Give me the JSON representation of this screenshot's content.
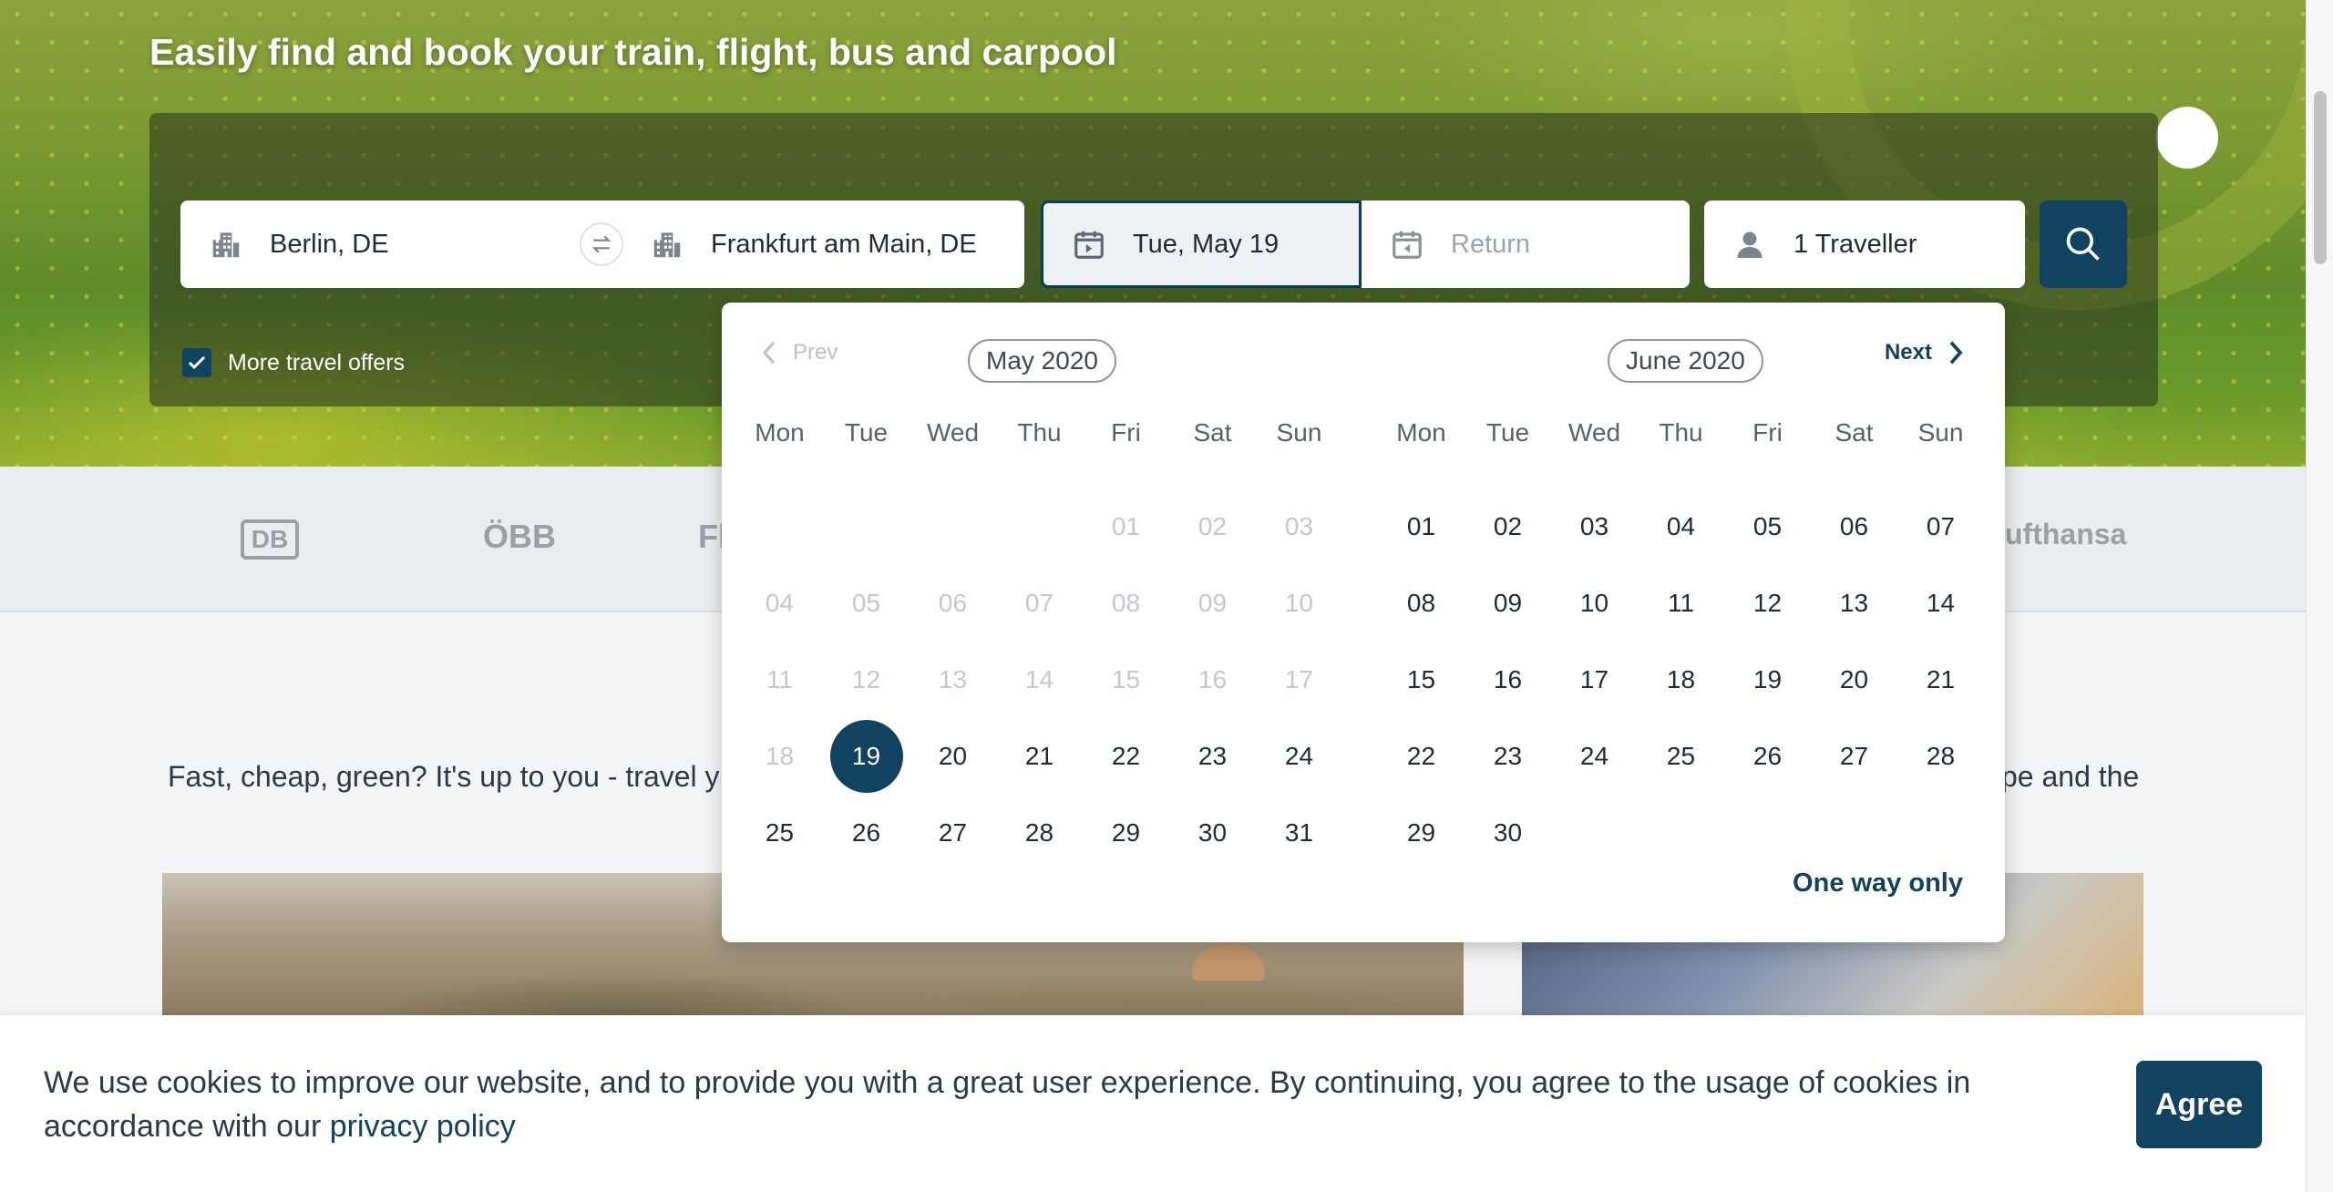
{
  "hero": {
    "title": "Easily find and book your train, flight, bus and carpool"
  },
  "search": {
    "from_value": "Berlin, DE",
    "to_value": "Frankfurt am Main, DE",
    "depart_value": "Tue, May 19",
    "return_placeholder": "Return",
    "travellers_value": "1 Traveller",
    "more_offers_label": "More travel offers",
    "more_offers_checked": true,
    "icons": {
      "from": "building-icon",
      "to": "building-icon",
      "swap": "swap-arrows-icon",
      "depart": "calendar-icon",
      "return": "calendar-icon",
      "travellers": "person-icon",
      "search": "search-icon"
    }
  },
  "calendar": {
    "prev_label": "Prev",
    "next_label": "Next",
    "one_way_label": "One way only",
    "weekdays": [
      "Mon",
      "Tue",
      "Wed",
      "Thu",
      "Fri",
      "Sat",
      "Sun"
    ],
    "selected_day": "19",
    "months": [
      {
        "label": "May 2020",
        "weeks": [
          [
            "",
            "",
            "",
            "",
            "01",
            "02",
            "03"
          ],
          [
            "04",
            "05",
            "06",
            "07",
            "08",
            "09",
            "10"
          ],
          [
            "11",
            "12",
            "13",
            "14",
            "15",
            "16",
            "17"
          ],
          [
            "18",
            "19",
            "20",
            "21",
            "22",
            "23",
            "24"
          ],
          [
            "25",
            "26",
            "27",
            "28",
            "29",
            "30",
            "31"
          ]
        ],
        "disabled_through": 18,
        "selected": 19
      },
      {
        "label": "June 2020",
        "weeks": [
          [
            "01",
            "02",
            "03",
            "04",
            "05",
            "06",
            "07"
          ],
          [
            "08",
            "09",
            "10",
            "11",
            "12",
            "13",
            "14"
          ],
          [
            "15",
            "16",
            "17",
            "18",
            "19",
            "20",
            "21"
          ],
          [
            "22",
            "23",
            "24",
            "25",
            "26",
            "27",
            "28"
          ],
          [
            "29",
            "30",
            "",
            "",
            "",
            "",
            ""
          ]
        ],
        "disabled_through": 0,
        "selected": null
      }
    ]
  },
  "partners": {
    "db": "DB",
    "obb": "ÖBB",
    "fl_partial": "Fl",
    "lufthansa_partial": "ufthansa"
  },
  "content": {
    "tagline_left": "Fast, cheap, green? It's up to you - travel y",
    "tagline_right": "pe and the"
  },
  "cookie": {
    "text": "We use cookies to improve our website, and to provide you with a great user experience. By continuing, you agree to the usage of cookies in accordance with our ",
    "link": "privacy policy",
    "agree_label": "Agree"
  },
  "colors": {
    "primary": "#11425f",
    "disabled_day": "#c2c8ce"
  }
}
